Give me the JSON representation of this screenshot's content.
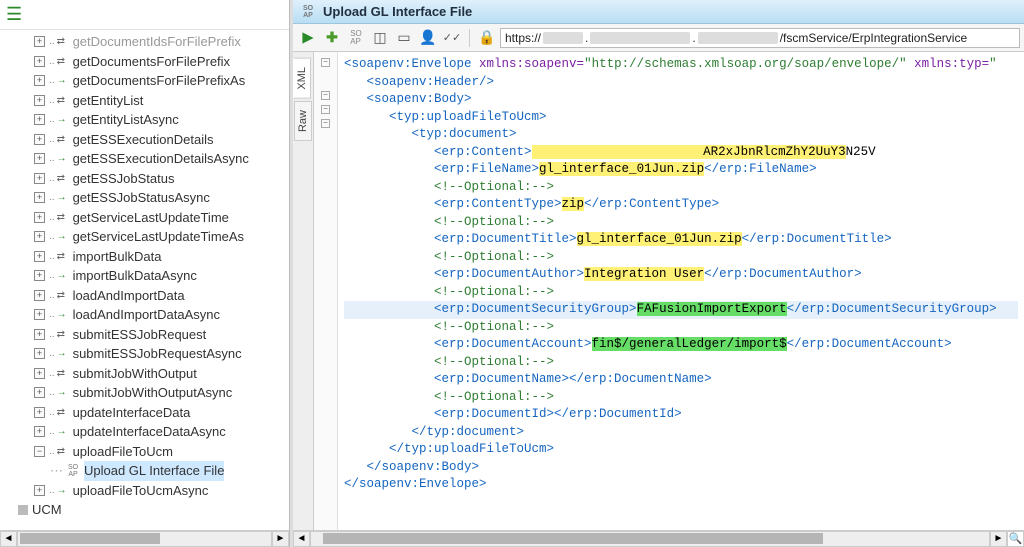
{
  "topnav_cutoff": "getDocumentIdsForFilePrefix",
  "tree": {
    "items": [
      "getDocumentsForFilePrefix",
      "getDocumentsForFilePrefixAs",
      "getEntityList",
      "getEntityListAsync",
      "getESSExecutionDetails",
      "getESSExecutionDetailsAsync",
      "getESSJobStatus",
      "getESSJobStatusAsync",
      "getServiceLastUpdateTime",
      "getServiceLastUpdateTimeAs",
      "importBulkData",
      "importBulkDataAsync",
      "loadAndImportData",
      "loadAndImportDataAsync",
      "submitESSJobRequest",
      "submitESSJobRequestAsync",
      "submitJobWithOutput",
      "submitJobWithOutputAsync",
      "updateInterfaceData",
      "updateInterfaceDataAsync",
      "uploadFileToUcm"
    ],
    "selected_child": "Upload GL Interface File",
    "after": "uploadFileToUcmAsync",
    "ucm": "UCM"
  },
  "title": "Upload GL Interface File",
  "tabs": {
    "xml": "XML",
    "raw": "Raw"
  },
  "url": {
    "prefix": "https://",
    "suffix": "/fscmService/ErpIntegrationService"
  },
  "xml": {
    "env_open_a": "<soapenv:Envelope",
    "env_xmlns": " xmlns:soapenv=",
    "env_ns": "\"http://schemas.xmlsoap.org/soap/envelope/\"",
    "env_xmlns2": " xmlns:typ=",
    "env_ns2_trail": "\"",
    "header": "<soapenv:Header/>",
    "body_open": "<soapenv:Body>",
    "upload_open": "<typ:uploadFileToUcm>",
    "doc_open": "<typ:document>",
    "content_open": "<erp:Content>",
    "content_blur_trail": "AR2xJbnRlcmZhY2UuY3",
    "content_trail2": "N25V",
    "filename_open": "<erp:FileName>",
    "filename_val": "gl_interface_01Jun.zip",
    "filename_close": "</erp:FileName>",
    "opt": "<!--Optional:-->",
    "ctype_open": "<erp:ContentType>",
    "ctype_val": "zip",
    "ctype_close": "</erp:ContentType>",
    "dtitle_open": "<erp:DocumentTitle>",
    "dtitle_val": "gl_interface_01Jun.zip",
    "dtitle_close": "</erp:DocumentTitle>",
    "dauth_open": "<erp:DocumentAuthor>",
    "dauth_val": "Integration User",
    "dauth_close": "</erp:DocumentAuthor>",
    "dsg_open": "<erp:DocumentSecurityGroup>",
    "dsg_val": "FAFusionImportExport",
    "dsg_close": "</erp:DocumentSecurityGroup>",
    "dacc_open": "<erp:DocumentAccount>",
    "dacc_val": "fin$/generalLedger/import$",
    "dacc_close": "</erp:DocumentAccount>",
    "dname_open": "<erp:DocumentName>",
    "dname_close": "</erp:DocumentName>",
    "did_open": "<erp:DocumentId>",
    "did_close": "</erp:DocumentId>",
    "doc_close": "</typ:document>",
    "upload_close": "</typ:uploadFileToUcm>",
    "body_close": "</soapenv:Body>",
    "env_close": "</soapenv:Envelope>"
  }
}
